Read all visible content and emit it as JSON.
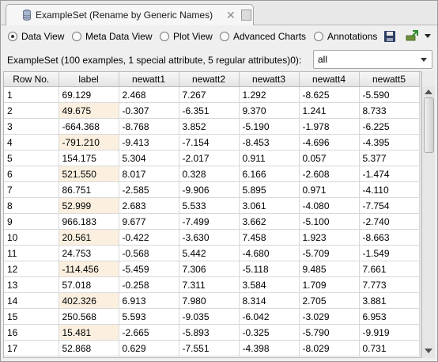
{
  "tab": {
    "title": "ExampleSet (Rename by Generic Names)",
    "close_glyph": "✕"
  },
  "views": [
    {
      "label": "Data View",
      "selected": true
    },
    {
      "label": "Meta Data View",
      "selected": false
    },
    {
      "label": "Plot View",
      "selected": false
    },
    {
      "label": "Advanced Charts",
      "selected": false
    },
    {
      "label": "Annotations",
      "selected": false
    }
  ],
  "icons": [
    "database-icon",
    "close-icon",
    "undock-icon",
    "save-icon",
    "export-icon",
    "dropdown-arrow-icon"
  ],
  "info_text": "ExampleSet (100 examples, 1 special attribute, 5 regular attributes)",
  "filter": {
    "count_suffix": "0):",
    "selected": "all"
  },
  "colors": {
    "special_column_even_row": "#fbf0e0"
  },
  "table": {
    "columns": [
      "Row No.",
      "label",
      "newatt1",
      "newatt2",
      "newatt3",
      "newatt4",
      "newatt5"
    ],
    "rows": [
      [
        "1",
        "69.129",
        "2.468",
        "7.267",
        "1.292",
        "-8.625",
        "-5.590"
      ],
      [
        "2",
        "49.675",
        "-0.307",
        "-6.351",
        "9.370",
        "1.241",
        "8.733"
      ],
      [
        "3",
        "-664.368",
        "-8.768",
        "3.852",
        "-5.190",
        "-1.978",
        "-6.225"
      ],
      [
        "4",
        "-791.210",
        "-9.413",
        "-7.154",
        "-8.453",
        "-4.696",
        "-4.395"
      ],
      [
        "5",
        "154.175",
        "5.304",
        "-2.017",
        "0.911",
        "0.057",
        "5.377"
      ],
      [
        "6",
        "521.550",
        "8.017",
        "0.328",
        "6.166",
        "-2.608",
        "-1.474"
      ],
      [
        "7",
        "86.751",
        "-2.585",
        "-9.906",
        "5.895",
        "0.971",
        "-4.110"
      ],
      [
        "8",
        "52.999",
        "2.683",
        "5.533",
        "3.061",
        "-4.080",
        "-7.754"
      ],
      [
        "9",
        "966.183",
        "9.677",
        "-7.499",
        "3.662",
        "-5.100",
        "-2.740"
      ],
      [
        "10",
        "20.561",
        "-0.422",
        "-3.630",
        "7.458",
        "1.923",
        "-8.663"
      ],
      [
        "11",
        "24.753",
        "-0.568",
        "5.442",
        "-4.680",
        "-5.709",
        "-1.549"
      ],
      [
        "12",
        "-114.456",
        "-5.459",
        "7.306",
        "-5.118",
        "9.485",
        "7.661"
      ],
      [
        "13",
        "57.018",
        "-0.258",
        "7.311",
        "3.584",
        "1.709",
        "7.773"
      ],
      [
        "14",
        "402.326",
        "6.913",
        "7.980",
        "8.314",
        "2.705",
        "3.881"
      ],
      [
        "15",
        "250.568",
        "5.593",
        "-9.035",
        "-6.042",
        "-3.029",
        "6.953"
      ],
      [
        "16",
        "15.481",
        "-2.665",
        "-5.893",
        "-0.325",
        "-5.790",
        "-9.919"
      ],
      [
        "17",
        "52.868",
        "0.629",
        "-7.551",
        "-4.398",
        "-8.029",
        "0.731"
      ]
    ]
  }
}
